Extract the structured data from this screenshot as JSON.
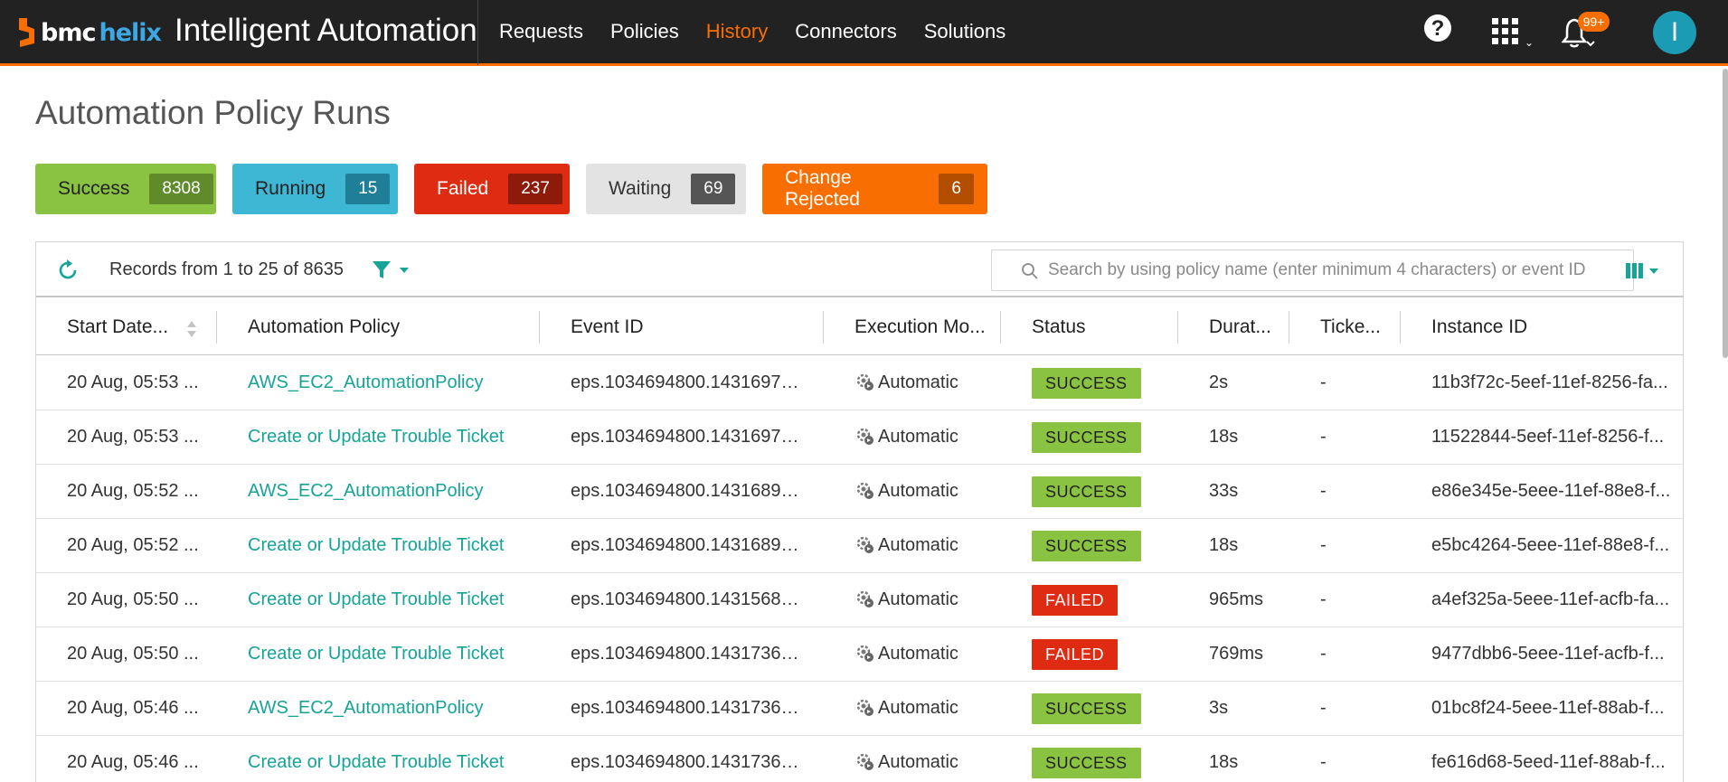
{
  "header": {
    "logo_bmc": "bmc",
    "logo_helix": "helix",
    "app_title": "Intelligent Automation",
    "nav": [
      {
        "label": "Requests",
        "active": false
      },
      {
        "label": "Policies",
        "active": false
      },
      {
        "label": "History",
        "active": true
      },
      {
        "label": "Connectors",
        "active": false
      },
      {
        "label": "Solutions",
        "active": false
      }
    ],
    "help_label": "?",
    "notifications_badge": "99+",
    "avatar_initial": "I",
    "accent_color": "#f86e00"
  },
  "page": {
    "title": "Automation Policy Runs"
  },
  "status_filters": [
    {
      "label": "Success",
      "count": "8308",
      "color": "#89c341"
    },
    {
      "label": "Running",
      "count": "15",
      "color": "#3eb7d4"
    },
    {
      "label": "Failed",
      "count": "237",
      "color": "#df2b12"
    },
    {
      "label": "Waiting",
      "count": "69",
      "color": "#e3e3e3"
    },
    {
      "label": "Change Rejected",
      "count": "6",
      "color": "#f86e00"
    }
  ],
  "toolbar": {
    "records_text": "Records from 1 to 25 of 8635",
    "search_placeholder": "Search by using policy name (enter minimum 4 characters) or event ID",
    "search_value": ""
  },
  "table": {
    "columns": [
      "Start Date...",
      "Automation Policy",
      "Event ID",
      "Execution Mo...",
      "Status",
      "Durat...",
      "Ticke...",
      "Instance ID"
    ],
    "rows": [
      {
        "start": "20 Aug, 05:53 ...",
        "policy": "AWS_EC2_AutomationPolicy",
        "event": "eps.1034694800.14316970...",
        "mode": "Automatic",
        "status": "SUCCESS",
        "duration": "2s",
        "ticket": "-",
        "instance": "11b3f72c-5eef-11ef-8256-fa..."
      },
      {
        "start": "20 Aug, 05:53 ...",
        "policy": "Create or Update Trouble Ticket",
        "event": "eps.1034694800.14316970...",
        "mode": "Automatic",
        "status": "SUCCESS",
        "duration": "18s",
        "ticket": "-",
        "instance": "11522844-5eef-11ef-8256-f..."
      },
      {
        "start": "20 Aug, 05:52 ...",
        "policy": "AWS_EC2_AutomationPolicy",
        "event": "eps.1034694800.14316897...",
        "mode": "Automatic",
        "status": "SUCCESS",
        "duration": "33s",
        "ticket": "-",
        "instance": "e86e345e-5eee-11ef-88e8-f..."
      },
      {
        "start": "20 Aug, 05:52 ...",
        "policy": "Create or Update Trouble Ticket",
        "event": "eps.1034694800.14316897...",
        "mode": "Automatic",
        "status": "SUCCESS",
        "duration": "18s",
        "ticket": "-",
        "instance": "e5bc4264-5eee-11ef-88e8-f..."
      },
      {
        "start": "20 Aug, 05:50 ...",
        "policy": "Create or Update Trouble Ticket",
        "event": "eps.1034694800.14315685...",
        "mode": "Automatic",
        "status": "FAILED",
        "duration": "965ms",
        "ticket": "-",
        "instance": "a4ef325a-5eee-11ef-acfb-fa..."
      },
      {
        "start": "20 Aug, 05:50 ...",
        "policy": "Create or Update Trouble Ticket",
        "event": "eps.1034694800.14317367...",
        "mode": "Automatic",
        "status": "FAILED",
        "duration": "769ms",
        "ticket": "-",
        "instance": "9477dbb6-5eee-11ef-acfb-f..."
      },
      {
        "start": "20 Aug, 05:46 ...",
        "policy": "AWS_EC2_AutomationPolicy",
        "event": "eps.1034694800.14317367...",
        "mode": "Automatic",
        "status": "SUCCESS",
        "duration": "3s",
        "ticket": "-",
        "instance": "01bc8f24-5eee-11ef-88ab-f..."
      },
      {
        "start": "20 Aug, 05:46 ...",
        "policy": "Create or Update Trouble Ticket",
        "event": "eps.1034694800.14317367...",
        "mode": "Automatic",
        "status": "SUCCESS",
        "duration": "18s",
        "ticket": "-",
        "instance": "fe616d68-5eed-11ef-88ab-f..."
      }
    ]
  },
  "icons": {
    "refresh": "refresh-icon",
    "filter": "filter-icon",
    "search": "search-icon",
    "columns": "column-chooser-icon",
    "apps": "app-grid-icon",
    "notifications": "bell-icon",
    "execution_mode": "gear-auto-icon"
  }
}
